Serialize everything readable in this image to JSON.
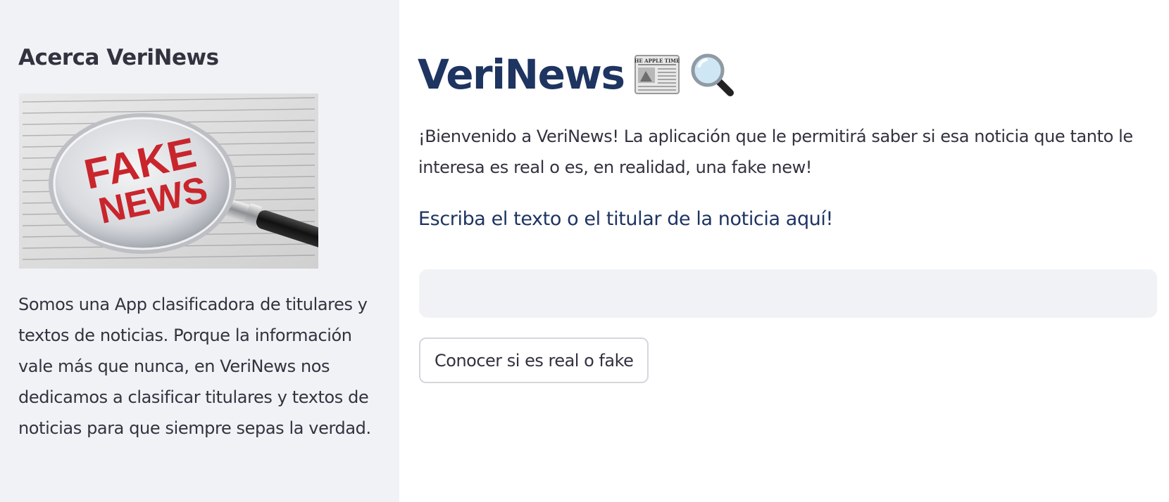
{
  "sidebar": {
    "title": "Acerca VeriNews",
    "image": {
      "icon": "magnifying-glass-over-newspaper",
      "text": "FAKE NEWS",
      "text_line_1": "FAKE",
      "text_line_2": "NEWS"
    },
    "description": "Somos una App clasificadora de titulares y textos de noticias. Porque la información vale más que nunca, en VeriNews nos dedicamos a clasificar titulares y textos de noticias para que siempre sepas la verdad."
  },
  "main": {
    "title": "VeriNews",
    "title_icons": [
      "newspaper-icon",
      "magnifying-glass-icon"
    ],
    "newspaper_icon_text": "THE APPLE TIMES",
    "welcome": "¡Bienvenido a VeriNews! La aplicación que le permitirá saber si esa noticia que tanto le interesa es real o es, en realidad, una fake new!",
    "input_label": "Escriba el texto o el titular de la noticia aquí!",
    "input_value": "",
    "button_label": "Conocer si es real o fake"
  },
  "colors": {
    "sidebar_bg": "#f0f2f6",
    "title": "#1e3461",
    "text": "#31333f",
    "input_bg": "#f0f2f6",
    "button_border": "#d5d7dc",
    "fake_news_red": "#c9252c"
  }
}
